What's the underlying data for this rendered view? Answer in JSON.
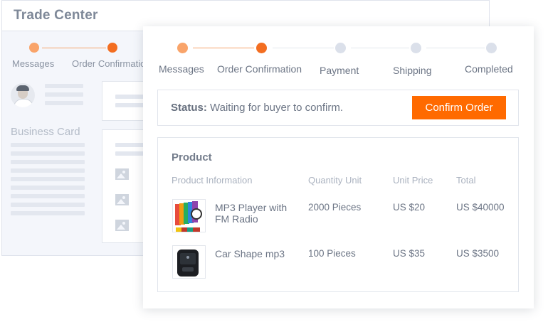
{
  "background_window": {
    "title": "Trade Center",
    "steps": [
      "Messages",
      "Order Confirmation"
    ],
    "business_card_label": "Business Card"
  },
  "steps": [
    {
      "label": "Messages",
      "state": "done"
    },
    {
      "label": "Order Confirmation",
      "state": "current"
    },
    {
      "label": "Payment",
      "state": "pending"
    },
    {
      "label": "Shipping",
      "state": "pending"
    },
    {
      "label": "Completed",
      "state": "pending"
    }
  ],
  "status": {
    "label": "Status:",
    "text": "Waiting for buyer to confirm.",
    "button_label": "Confirm Order"
  },
  "product": {
    "title": "Product",
    "columns": [
      "Product Information",
      "Quantity Unit",
      "Unit Price",
      "Total"
    ],
    "rows": [
      {
        "name": "MP3 Player with FM Radio",
        "quantity": "2000 Pieces",
        "unit_price": "US $20",
        "total": "US $40000",
        "thumb_icon": "mp3-player-stack-icon"
      },
      {
        "name": "Car Shape mp3",
        "quantity": "100 Pieces",
        "unit_price": "US $35",
        "total": "US $3500",
        "thumb_icon": "car-mp3-player-icon"
      }
    ]
  },
  "colors": {
    "accent": "#ff6a00",
    "step_done": "#f9a46a",
    "step_current": "#f36e21",
    "step_pending": "#dbe0ea"
  }
}
